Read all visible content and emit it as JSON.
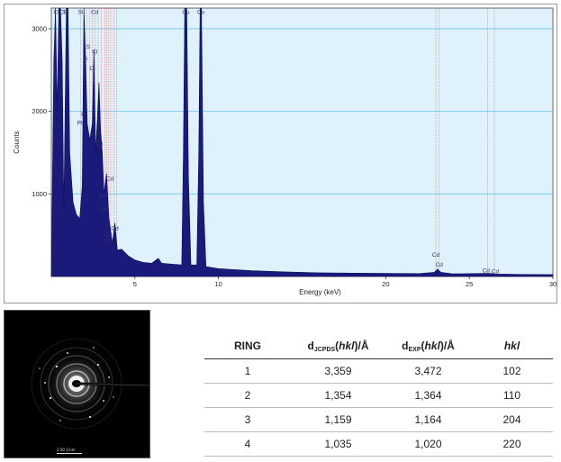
{
  "chart_data": {
    "type": "area",
    "title": "",
    "xlabel": "Energy (keV)",
    "ylabel": "Counts",
    "xlim": [
      0,
      30
    ],
    "ylim": [
      0,
      3250
    ],
    "x_ticks": [
      5,
      10,
      20,
      25,
      30
    ],
    "x_tick_labels": [
      "5",
      "10",
      "20",
      "25",
      "30"
    ],
    "y_ticks": [
      1000,
      2000,
      3000
    ],
    "y_tick_labels": [
      "1000",
      "2000",
      "3000"
    ],
    "grid": true,
    "series": [
      {
        "points": [
          [
            0.0,
            0
          ],
          [
            0.15,
            2600
          ],
          [
            0.25,
            3250
          ],
          [
            0.35,
            2000
          ],
          [
            0.45,
            3250
          ],
          [
            0.55,
            3250
          ],
          [
            0.65,
            2600
          ],
          [
            0.75,
            800
          ],
          [
            0.9,
            3250
          ],
          [
            1.0,
            3250
          ],
          [
            1.1,
            1500
          ],
          [
            1.3,
            900
          ],
          [
            1.5,
            750
          ],
          [
            1.7,
            700
          ],
          [
            1.85,
            1100
          ],
          [
            1.95,
            3250
          ],
          [
            2.05,
            2600
          ],
          [
            2.15,
            1850
          ],
          [
            2.3,
            1650
          ],
          [
            2.45,
            1850
          ],
          [
            2.55,
            2750
          ],
          [
            2.65,
            1500
          ],
          [
            2.75,
            1900
          ],
          [
            2.85,
            2350
          ],
          [
            2.95,
            1750
          ],
          [
            3.05,
            1500
          ],
          [
            3.15,
            1000
          ],
          [
            3.3,
            1250
          ],
          [
            3.45,
            700
          ],
          [
            3.55,
            550
          ],
          [
            3.65,
            400
          ],
          [
            3.8,
            650
          ],
          [
            3.95,
            320
          ],
          [
            4.2,
            330
          ],
          [
            4.6,
            250
          ],
          [
            5.0,
            200
          ],
          [
            5.5,
            170
          ],
          [
            6.0,
            160
          ],
          [
            6.4,
            220
          ],
          [
            6.6,
            160
          ],
          [
            7.2,
            150
          ],
          [
            7.8,
            140
          ],
          [
            7.9,
            1500
          ],
          [
            7.98,
            3250
          ],
          [
            8.1,
            3250
          ],
          [
            8.2,
            1200
          ],
          [
            8.35,
            140
          ],
          [
            8.7,
            140
          ],
          [
            8.82,
            1500
          ],
          [
            8.9,
            3250
          ],
          [
            8.98,
            3250
          ],
          [
            9.1,
            900
          ],
          [
            9.25,
            120
          ],
          [
            10,
            95
          ],
          [
            12,
            70
          ],
          [
            14,
            55
          ],
          [
            16,
            45
          ],
          [
            18,
            40
          ],
          [
            20,
            38
          ],
          [
            22,
            35
          ],
          [
            22.9,
            50
          ],
          [
            23.1,
            90
          ],
          [
            23.3,
            50
          ],
          [
            24,
            32
          ],
          [
            26.2,
            38
          ],
          [
            26.6,
            30
          ],
          [
            28,
            26
          ],
          [
            30,
            22
          ]
        ]
      }
    ],
    "peak_labels": [
      {
        "text": "Cl",
        "x": 0.3,
        "y": 3180
      },
      {
        "text": "Cl",
        "x": 0.65,
        "y": 3180
      },
      {
        "text": "Si",
        "x": 0.85,
        "y": 3180
      },
      {
        "text": "Si",
        "x": 1.75,
        "y": 3180
      },
      {
        "text": "Cd",
        "x": 2.6,
        "y": 3180
      },
      {
        "text": "S",
        "x": 2.2,
        "y": 2760
      },
      {
        "text": "S",
        "x": 2.05,
        "y": 2620
      },
      {
        "text": "Cl",
        "x": 2.6,
        "y": 2700
      },
      {
        "text": "Cl",
        "x": 2.45,
        "y": 2500
      },
      {
        "text": "P",
        "x": 1.9,
        "y": 1940
      },
      {
        "text": "Pt",
        "x": 1.7,
        "y": 1840
      },
      {
        "text": "Cd",
        "x": 2.85,
        "y": 1580
      },
      {
        "text": "Cd",
        "x": 3.5,
        "y": 1160
      },
      {
        "text": "Cd",
        "x": 3.1,
        "y": 960
      },
      {
        "text": "Cd",
        "x": 3.1,
        "y": 790
      },
      {
        "text": "Cd",
        "x": 3.8,
        "y": 560
      },
      {
        "text": "Cd",
        "x": 3.4,
        "y": 480
      },
      {
        "text": "Cd",
        "x": 3.45,
        "y": 400
      },
      {
        "text": "Cu",
        "x": 8.05,
        "y": 3180
      },
      {
        "text": "Cu",
        "x": 8.95,
        "y": 3180
      },
      {
        "text": "Cd",
        "x": 23.0,
        "y": 240
      },
      {
        "text": "Cd",
        "x": 23.2,
        "y": 120
      },
      {
        "text": "Cd",
        "x": 26.0,
        "y": 50
      },
      {
        "text": "Cd",
        "x": 26.55,
        "y": 40
      }
    ],
    "marker_lines": [
      0.25,
      0.5,
      0.9,
      1.75,
      1.95,
      2.1,
      2.3,
      2.45,
      2.6,
      2.8,
      3.0,
      3.2,
      3.3,
      3.4,
      3.55,
      3.75,
      3.9,
      8.05,
      8.9,
      23.0,
      23.2,
      26.1,
      26.5
    ]
  },
  "colors": {
    "plot_bg": "#dff2fb",
    "area_fill": "#1a1a7a",
    "grid": "#6ec6e6",
    "marker": "#e05050",
    "peak_label": "#333366"
  },
  "saed_image": {
    "scale_label": "2.00 1/nm"
  },
  "table": {
    "headers": {
      "ring": "RING",
      "d_jcpds_prefix": "d",
      "d_jcpds_sub": "JCPDS",
      "d_jcpds_suffix": "(hkl)/Å",
      "d_exp_prefix": "d",
      "d_exp_sub": "EXP",
      "d_exp_suffix": "(hkl)/Å",
      "hkl": "hkl"
    },
    "rows": [
      {
        "ring": "1",
        "d_jcpds": "3,359",
        "d_exp": "3,472",
        "hkl": "102"
      },
      {
        "ring": "2",
        "d_jcpds": "1,354",
        "d_exp": "1,364",
        "hkl": "110"
      },
      {
        "ring": "3",
        "d_jcpds": "1,159",
        "d_exp": "1,164",
        "hkl": "204"
      },
      {
        "ring": "4",
        "d_jcpds": "1,035",
        "d_exp": "1,020",
        "hkl": "220"
      }
    ]
  }
}
